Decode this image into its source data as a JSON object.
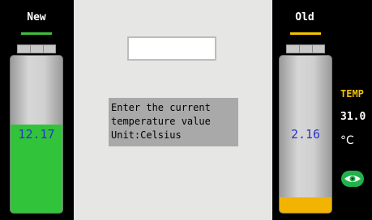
{
  "left_battery": {
    "label": "New",
    "value": "12.17",
    "fill_fraction": 0.56,
    "fill_color": "#31c43a",
    "indicator_color": "#3fbf3a"
  },
  "dialog": {
    "input_value": "",
    "prompt_lines": "Enter the current\ntemperature value\nUnit:Celsius"
  },
  "right_battery": {
    "label": "Old",
    "value": "2.16",
    "fill_fraction": 0.1,
    "fill_color": "#f2b400",
    "indicator_color": "#f2c200"
  },
  "temperature": {
    "label": "TEMP",
    "value": "31.0",
    "unit": "°C"
  },
  "icons": {
    "view_toggle": "eye-icon"
  }
}
